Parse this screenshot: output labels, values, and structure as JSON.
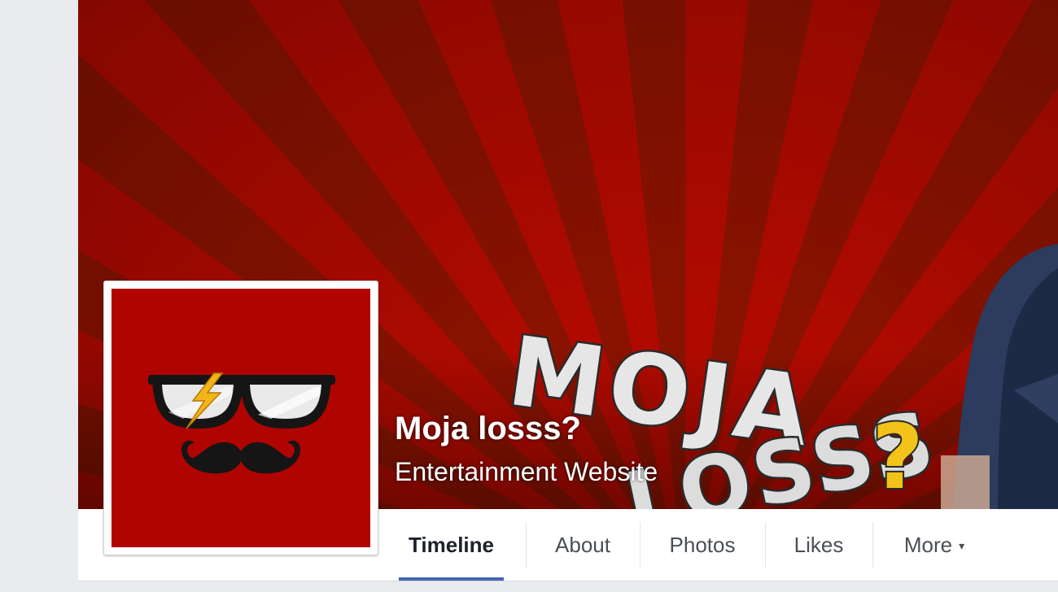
{
  "page": {
    "name": "Moja losss?",
    "category": "Entertainment Website"
  },
  "cover": {
    "logo_line1": "MOJA",
    "logo_line2": "LOSSS",
    "logo_q": "?",
    "background_color": "#b00a00",
    "ray_color": "#8a1200"
  },
  "profile_picture": {
    "background_color": "#b00400"
  },
  "nav": {
    "tabs": [
      {
        "label": "Timeline",
        "active": true
      },
      {
        "label": "About",
        "active": false
      },
      {
        "label": "Photos",
        "active": false
      },
      {
        "label": "Likes",
        "active": false
      },
      {
        "label": "More",
        "active": false
      }
    ],
    "more_caret": "▾",
    "active_color": "#4267b2"
  }
}
